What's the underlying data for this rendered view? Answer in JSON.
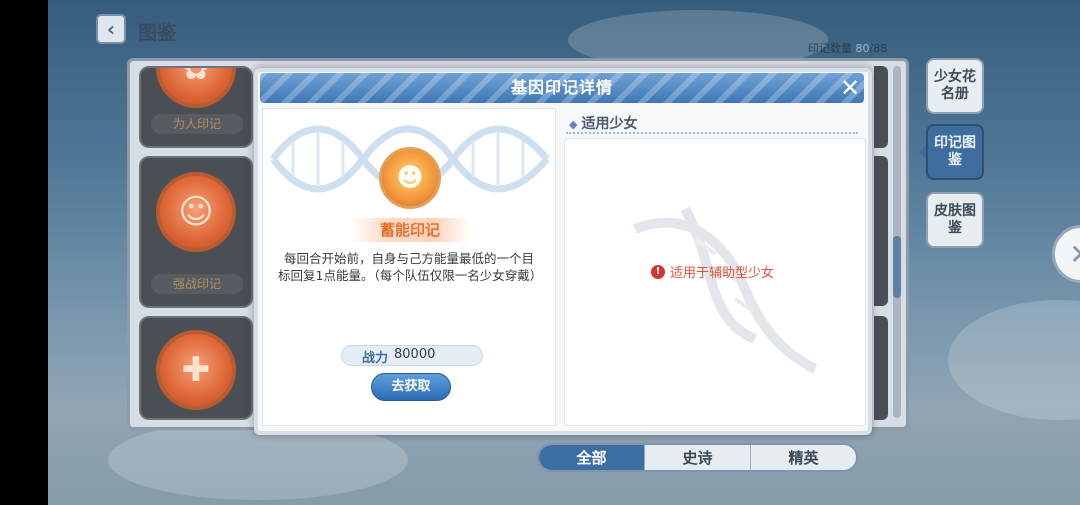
{
  "header": {
    "back_icon": "‹",
    "title": "图鉴"
  },
  "count": {
    "label": "印记数量",
    "current": "80",
    "total": "/88"
  },
  "cards": [
    {
      "label": "为人印记"
    },
    {
      "label": "强战印记"
    },
    {
      "label": ""
    }
  ],
  "side_tabs": [
    {
      "label": "少女花名册"
    },
    {
      "label": "印记图鉴"
    },
    {
      "label": "皮肤图鉴"
    }
  ],
  "filter": {
    "tabs": [
      "全部",
      "史诗",
      "精英"
    ],
    "selected": "全部"
  },
  "modal": {
    "title": "基因印记详情",
    "close_icon": "✕",
    "medal_name": "蓄能印记",
    "description": "每回合开始前，自身与己方能量最低的一个目标回复1点能量。（每个队伍仅限一名少女穿戴）",
    "power_label": "战力",
    "power_value": "80000",
    "get_button": "去获取",
    "right_heading": "适用少女",
    "warning_icon": "!",
    "warning_text": "适用于辅助型少女"
  },
  "side_close_icon": "✕",
  "colors": {
    "accent": "#3c6ea3",
    "orange": "#e57231",
    "warning": "#d6362f"
  }
}
